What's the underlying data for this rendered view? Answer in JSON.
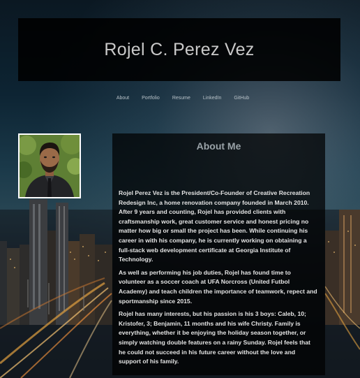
{
  "header": {
    "name": "Rojel C. Perez Vez"
  },
  "nav": {
    "items": [
      {
        "label": "About"
      },
      {
        "label": "Portfolio"
      },
      {
        "label": "Resume"
      },
      {
        "label": "LinkedIn"
      },
      {
        "label": "GitHub"
      }
    ]
  },
  "about": {
    "title": "About Me",
    "paragraphs": [
      "Rojel Perez Vez is the President/Co-Founder of Creative Recreation Redesign Inc, a home renovation company founded in March 2010. After 9 years and counting, Rojel has provided clients with craftsmanship work, great customer service and honest pricing no matter how big or small the project has been. While continuing his career in with his company, he is currently working on obtaining a full-stack web development certificate at Georgia Institute of Technology.",
      "As well as performing his job duties, Rojel has found time to volunteer as a soccer coach at UFA Norcross (United Futbol Academy) and teach children the importance of teamwork, repect and sportmanship since 2015.",
      "Rojel has many interests, but his passion is his 3 boys: Caleb, 10; Kristofer, 3; Benjamin, 11 months and his wife Christy. Family is everything, whether it be enjoying the holiday season together, or simply watching double features on a rainy Sunday. Rojel feels that he could not succeed in his future career without the love and support of his family."
    ]
  },
  "colors": {
    "header_bg": "#000000",
    "header_text": "#c9c9c9",
    "nav_text": "#b8c2c8",
    "about_title": "#9aa3a8",
    "about_text": "#e4e4e4"
  }
}
